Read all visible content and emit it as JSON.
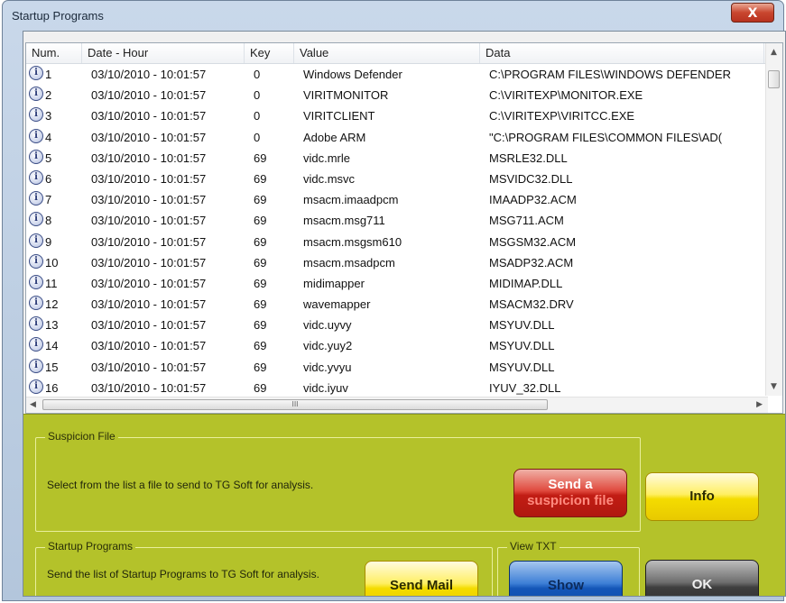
{
  "window": {
    "title": "Startup Programs",
    "close_label": "X"
  },
  "columns": [
    "Num.",
    "Date - Hour",
    "Key",
    "Value",
    "Data"
  ],
  "rows": [
    {
      "num": "1",
      "date": "03/10/2010 - 10:01:57",
      "key": "0",
      "value": "Windows Defender",
      "data": "C:\\PROGRAM FILES\\WINDOWS DEFENDER"
    },
    {
      "num": "2",
      "date": "03/10/2010 - 10:01:57",
      "key": "0",
      "value": "VIRITMONITOR",
      "data": "C:\\VIRITEXP\\MONITOR.EXE"
    },
    {
      "num": "3",
      "date": "03/10/2010 - 10:01:57",
      "key": "0",
      "value": "VIRITCLIENT",
      "data": "C:\\VIRITEXP\\VIRITCC.EXE"
    },
    {
      "num": "4",
      "date": "03/10/2010 - 10:01:57",
      "key": "0",
      "value": "Adobe ARM",
      "data": "\"C:\\PROGRAM FILES\\COMMON FILES\\AD("
    },
    {
      "num": "5",
      "date": "03/10/2010 - 10:01:57",
      "key": "69",
      "value": "vidc.mrle",
      "data": "MSRLE32.DLL"
    },
    {
      "num": "6",
      "date": "03/10/2010 - 10:01:57",
      "key": "69",
      "value": "vidc.msvc",
      "data": "MSVIDC32.DLL"
    },
    {
      "num": "7",
      "date": "03/10/2010 - 10:01:57",
      "key": "69",
      "value": "msacm.imaadpcm",
      "data": "IMAADP32.ACM"
    },
    {
      "num": "8",
      "date": "03/10/2010 - 10:01:57",
      "key": "69",
      "value": "msacm.msg711",
      "data": "MSG711.ACM"
    },
    {
      "num": "9",
      "date": "03/10/2010 - 10:01:57",
      "key": "69",
      "value": "msacm.msgsm610",
      "data": "MSGSM32.ACM"
    },
    {
      "num": "10",
      "date": "03/10/2010 - 10:01:57",
      "key": "69",
      "value": "msacm.msadpcm",
      "data": "MSADP32.ACM"
    },
    {
      "num": "11",
      "date": "03/10/2010 - 10:01:57",
      "key": "69",
      "value": "midimapper",
      "data": "MIDIMAP.DLL"
    },
    {
      "num": "12",
      "date": "03/10/2010 - 10:01:57",
      "key": "69",
      "value": "wavemapper",
      "data": "MSACM32.DRV"
    },
    {
      "num": "13",
      "date": "03/10/2010 - 10:01:57",
      "key": "69",
      "value": "vidc.uyvy",
      "data": "MSYUV.DLL"
    },
    {
      "num": "14",
      "date": "03/10/2010 - 10:01:57",
      "key": "69",
      "value": "vidc.yuy2",
      "data": "MSYUV.DLL"
    },
    {
      "num": "15",
      "date": "03/10/2010 - 10:01:57",
      "key": "69",
      "value": "vidc.yvyu",
      "data": "MSYUV.DLL"
    },
    {
      "num": "16",
      "date": "03/10/2010 - 10:01:57",
      "key": "69",
      "value": "vidc.iyuv",
      "data": "IYUV_32.DLL"
    }
  ],
  "scrollbar": {
    "thumb_grip": "III",
    "left_arrow": "◀",
    "right_arrow": "▶",
    "up_arrow": "▲",
    "down_arrow": "▼"
  },
  "suspicion": {
    "legend": "Suspicion File",
    "text": "Select from the list a file to send to TG Soft for analysis.",
    "send_button_line1": "Send a",
    "send_button_line2": "suspicion file",
    "info_button": "Info"
  },
  "startup": {
    "legend": "Startup Programs",
    "text": "Send the list of Startup Programs to TG Soft for analysis.",
    "mail_button": "Send Mail"
  },
  "view_txt": {
    "legend": "View TXT",
    "show_button": "Show"
  },
  "ok_button": "OK",
  "colors": {
    "panel": "#b4c22a",
    "red_button": "#c21d14",
    "yellow_button": "#f4dc00",
    "blue_button": "#1456b8",
    "gray_button": "#3e3e3e"
  }
}
